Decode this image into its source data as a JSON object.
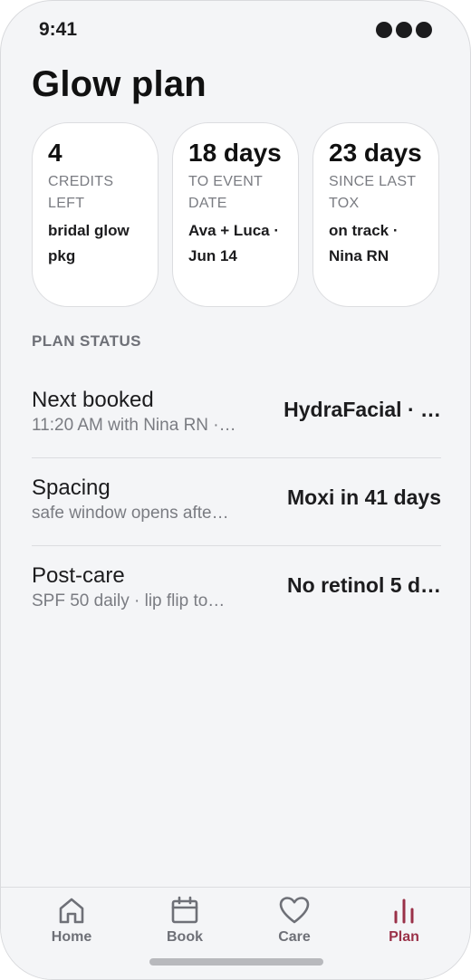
{
  "status_bar": {
    "time": "9:41"
  },
  "page": {
    "title": "Glow plan"
  },
  "stats": [
    {
      "value": "4",
      "label": "CREDITS LEFT",
      "detail": "bridal glow pkg"
    },
    {
      "value": "18 days",
      "label": "TO EVENT DATE",
      "detail": "Ava + Luca · Jun 14"
    },
    {
      "value": "23 days",
      "label": "SINCE LAST TOX",
      "detail": "on track · Nina RN"
    }
  ],
  "plan_status": {
    "header": "PLAN STATUS",
    "rows": [
      {
        "title": "Next booked",
        "subtitle": "11:20 AM with Nina RN ·…",
        "value": "HydraFacial · …"
      },
      {
        "title": "Spacing",
        "subtitle": "safe window opens afte…",
        "value": "Moxi in 41 days"
      },
      {
        "title": "Post-care",
        "subtitle": "SPF 50 daily · lip flip to…",
        "value": "No retinol 5 d…"
      }
    ]
  },
  "tabs": [
    {
      "label": "Home",
      "icon": "home-icon",
      "active": false
    },
    {
      "label": "Book",
      "icon": "calendar-icon",
      "active": false
    },
    {
      "label": "Care",
      "icon": "heart-icon",
      "active": false
    },
    {
      "label": "Plan",
      "icon": "bar-chart-icon",
      "active": true
    }
  ],
  "colors": {
    "accent": "#9a3148",
    "background": "#f4f5f7",
    "card": "#ffffff",
    "text_primary": "#1c1c1e",
    "text_secondary": "#7a7c82"
  }
}
